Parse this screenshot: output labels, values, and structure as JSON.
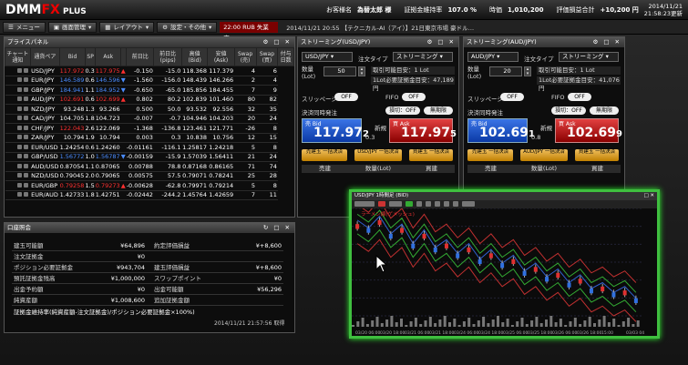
{
  "header": {
    "logo_main": "DMM",
    "logo_fx": "FX",
    "logo_plus": " PLUS",
    "customer_label": "お客様名",
    "customer_name": "為替太郎 様",
    "margin_rate_label": "証拠金維持率",
    "margin_rate": "107.0 %",
    "valuation_label": "時価",
    "valuation": "1,010,200",
    "pnl_label": "評価損益合計",
    "pnl": "+10,200 円",
    "date": "2014/11/21",
    "time": "21:58:23更新"
  },
  "toolbar": {
    "menu": "メニュー",
    "screen": "画面管理",
    "layout": "レイアウト",
    "settings": "設定・その他",
    "alert_time": "22:00",
    "alert_text": "RUB 失業率",
    "ticker": "2014/11/21 20:55 【テクニカル-AI（アイ）】21日東京市場 豪ドル…"
  },
  "rates": {
    "title": "プライスパネル",
    "headers": [
      "チャート 通知",
      "通貨ペア",
      "Bid",
      "SP",
      "Ask",
      "",
      "前日比",
      "前日比 (pips)",
      "高値 (Bid)",
      "安値 (Ask)",
      "Swap (売)",
      "Swap (買)",
      "付与 日数"
    ],
    "rows": [
      [
        "USD/JPY",
        "117.972",
        "0.3",
        "117.975",
        "-0.150",
        "-15.0",
        "118.368",
        "117.379",
        "4",
        "6",
        "3"
      ],
      [
        "EUR/JPY",
        "146.589",
        "0.6",
        "146.596",
        "-1.560",
        "-156.0",
        "148.439",
        "146.266",
        "2",
        "4",
        "3"
      ],
      [
        "GBP/JPY",
        "184.941",
        "1.1",
        "184.952",
        "-0.650",
        "-65.0",
        "185.856",
        "184.455",
        "7",
        "9",
        "3"
      ],
      [
        "AUD/JPY",
        "102.691",
        "0.6",
        "102.699",
        "0.802",
        "80.2",
        "102.839",
        "101.460",
        "80",
        "82",
        "3"
      ],
      [
        "NZD/JPY",
        "93.248",
        "1.3",
        "93.266",
        "0.500",
        "50.0",
        "93.532",
        "92.556",
        "32",
        "35",
        "3"
      ],
      [
        "CAD/JPY",
        "104.705",
        "1.8",
        "104.723",
        "-0.007",
        "-0.7",
        "104.946",
        "104.203",
        "20",
        "24",
        "3"
      ],
      [
        "CHF/JPY",
        "122.043",
        "2.6",
        "122.069",
        "-1.368",
        "-136.8",
        "123.461",
        "121.771",
        "-26",
        "8",
        "3"
      ],
      [
        "ZAR/JPY",
        "10.794",
        "1.9",
        "10.794",
        "0.003",
        "0.3",
        "10.838",
        "10.756",
        "12",
        "15",
        "3"
      ],
      [
        "EUR/USD",
        "1.24254",
        "0.6",
        "1.24260",
        "-0.01161",
        "-116.1",
        "1.25817",
        "1.24218",
        "5",
        "8",
        "3"
      ],
      [
        "GBP/USD",
        "1.56772",
        "1.0",
        "1.56787",
        "-0.00159",
        "-15.9",
        "1.57039",
        "1.56411",
        "21",
        "24",
        "3"
      ],
      [
        "AUD/USD",
        "0.87054",
        "1.1",
        "0.87065",
        "0.00788",
        "78.8",
        "0.87168",
        "0.86165",
        "71",
        "74",
        "3"
      ],
      [
        "NZD/USD",
        "0.79045",
        "2.0",
        "0.79065",
        "0.00575",
        "57.5",
        "0.79071",
        "0.78241",
        "25",
        "28",
        "3"
      ],
      [
        "EUR/GBP",
        "0.79258",
        "1.5",
        "0.79273",
        "-0.00628",
        "-62.8",
        "0.79971",
        "0.79214",
        "5",
        "8",
        "3"
      ],
      [
        "EUR/AUD",
        "1.42733",
        "1.8",
        "1.42751",
        "-0.02442",
        "-244.2",
        "1.45764",
        "1.42659",
        "7",
        "11",
        "3"
      ]
    ],
    "bid_dir": [
      "up",
      "dn",
      "dn",
      "up",
      "wh",
      "wh",
      "up",
      "wh",
      "wh",
      "dn",
      "wh",
      "wh",
      "up",
      "wh"
    ],
    "ask_dir": [
      "up",
      "dn",
      "dn",
      "up",
      "wh",
      "wh",
      "wh",
      "wh",
      "wh",
      "dn",
      "wh",
      "wh",
      "up",
      "wh"
    ]
  },
  "account": {
    "title": "口座照会",
    "rows": [
      {
        "l1": "建玉可能額",
        "v1": "¥64,896",
        "l2": "約定評価損益",
        "v2": "¥+8,600"
      },
      {
        "l1": "注文証拠金",
        "v1": "¥0",
        "l2": "",
        "v2": ""
      },
      {
        "l1": "ポジション必要証拠金",
        "v1": "¥943,704",
        "l2": "建玉評価損益",
        "v2": "¥+8,600"
      },
      {
        "l1": "預託証拠金残高",
        "v1": "¥1,000,000",
        "l2": "スワップポイント",
        "v2": "¥0"
      },
      {
        "l1": "出金予約額",
        "v1": "¥0",
        "l2": "出金可能額",
        "v2": "¥56,296"
      },
      {
        "l1": "純資産額",
        "v1": "¥1,008,600",
        "l2": "追加証拠金額",
        "v2": ""
      }
    ],
    "formula": "証拠金維持率(純資産額-注文証拠金)/ポジション必要証拠金×100%)",
    "updated": "2014/11/21 21:57:56 取得"
  },
  "stream1": {
    "title": "ストリーミング(USD/JPY)",
    "pair": "USD/JPY",
    "order_type_label": "注文タイプ",
    "order_type": "ストリーミング",
    "qty_label": "数量 (Lot)",
    "qty": "50",
    "max_label": "取引可能目安：1 Lot",
    "req_label": "1Lot必要証拠金目安：47,189円",
    "slip_label": "スリッページ",
    "off": "OFF",
    "fifo": "FIFO",
    "settle_label": "決済同時発注",
    "limit": "損切：OFF",
    "unlimited": "無期限",
    "bid_label": "売 Bid",
    "bid_big": "117.97",
    "bid_small": "2",
    "spread": "0.3",
    "new_label": "新規",
    "ask_label": "買 Ask",
    "ask_big": "117.97",
    "ask_small": "5",
    "btn1": "売建玉 一括決済",
    "btn2": "USD/JPY 一括決済",
    "btn3": "買建玉 一括決済",
    "col1": "売建",
    "col2": "数量(Lot)",
    "col3": "買建"
  },
  "stream2": {
    "title": "ストリーミング(AUD/JPY)",
    "pair": "AUD/JPY",
    "order_type_label": "注文タイプ",
    "order_type": "ストリーミング",
    "qty_label": "数量 (Lot)",
    "qty": "20",
    "max_label": "取引可能目安：1 Lot",
    "req_label": "1Lot必要証拠金目安：41,076円",
    "slip_label": "スリッページ",
    "off": "OFF",
    "fifo": "FIFO",
    "settle_label": "決済同時発注",
    "limit": "損切：OFF",
    "unlimited": "無期限",
    "bid_label": "売 Bid",
    "bid_big": "102.69",
    "bid_small": "1",
    "spread": "0.8",
    "new_label": "新規",
    "ask_label": "買 Ask",
    "ask_big": "102.69",
    "ask_small": "9",
    "btn1": "売建玉 一括決済",
    "btn2": "AUD/JPY 一括決済",
    "btn3": "買建玉 一括決済",
    "col1": "売建",
    "col2": "数量(Lot)",
    "col3": "買建"
  },
  "chart": {
    "title": "USD/JPY 1時間足 (BID)",
    "legend": "ラーメン線(ゲメッシュ)",
    "x_labels": [
      "03/20 06:00",
      "03/20 18:00",
      "03/21 06:00",
      "03/21 18:00",
      "03/24 06:00",
      "03/24 18:00",
      "03/25 06:00",
      "03/25 18:00",
      "03/26 06:00",
      "03/26 18:00",
      "15:00",
      "03/03 04"
    ],
    "colors": {
      "green": "#3fbf3f",
      "bid": "#1c56c8",
      "ask": "#c81c1c"
    }
  },
  "chart_data": {
    "type": "line",
    "title": "USD/JPY 1時間足 (BID)",
    "series": [
      {
        "name": "",
        "values": [
          62,
          58,
          64,
          55,
          60,
          50,
          57,
          48,
          52,
          45,
          50,
          42,
          47,
          40,
          44,
          36,
          40,
          33,
          37,
          30,
          34,
          27,
          30,
          25,
          28,
          22
        ]
      }
    ]
  }
}
